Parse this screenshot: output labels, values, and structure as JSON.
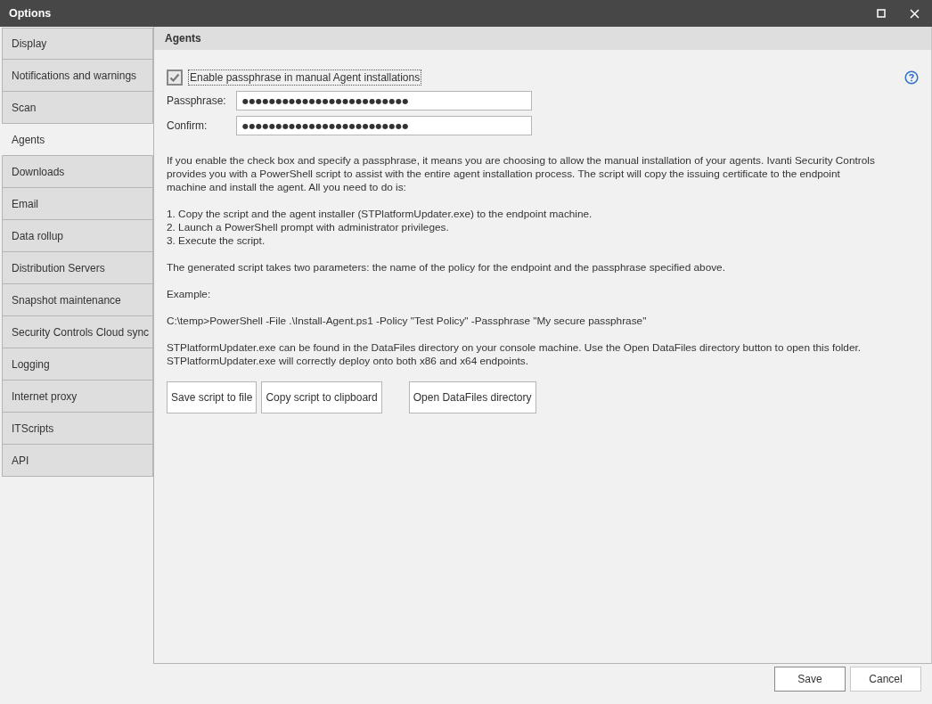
{
  "window": {
    "title": "Options"
  },
  "sidebar": {
    "items": [
      {
        "label": "Display",
        "selected": false
      },
      {
        "label": "Notifications and warnings",
        "selected": false
      },
      {
        "label": "Scan",
        "selected": false
      },
      {
        "label": "Agents",
        "selected": true
      },
      {
        "label": "Downloads",
        "selected": false
      },
      {
        "label": "Email",
        "selected": false
      },
      {
        "label": "Data rollup",
        "selected": false
      },
      {
        "label": "Distribution Servers",
        "selected": false
      },
      {
        "label": "Snapshot maintenance",
        "selected": false
      },
      {
        "label": "Security Controls Cloud sync",
        "selected": false
      },
      {
        "label": "Logging",
        "selected": false
      },
      {
        "label": "Internet proxy",
        "selected": false
      },
      {
        "label": "ITScripts",
        "selected": false
      },
      {
        "label": "API",
        "selected": false
      }
    ]
  },
  "panel": {
    "title": "Agents",
    "enable_checkbox": {
      "label": "Enable passphrase in manual Agent installations",
      "checked": true
    },
    "fields": [
      {
        "label": "Passphrase:",
        "value": "●●●●●●●●●●●●●●●●●●●●●●●●●"
      },
      {
        "label": "Confirm:",
        "value": "●●●●●●●●●●●●●●●●●●●●●●●●●"
      }
    ],
    "blocks": [
      {
        "lines": [
          "If you enable the check box and specify a passphrase, it means you are choosing to allow the manual installation of your agents. Ivanti Security Controls provides you with a PowerShell script to assist with the entire agent installation process. The script will copy the issuing certificate to the endpoint machine and install the agent. All you need to do is:"
        ]
      },
      {
        "lines": [
          "1. Copy the script and the agent installer (STPlatformUpdater.exe) to the endpoint machine.",
          "2. Launch a PowerShell prompt with administrator privileges.",
          "3. Execute the script."
        ]
      },
      {
        "lines": [
          "The generated script takes two parameters: the name of the policy for the endpoint and the passphrase specified above."
        ]
      },
      {
        "lines": [
          "Example:"
        ]
      },
      {
        "lines": [
          "C:\\temp>PowerShell -File .\\Install-Agent.ps1 -Policy \"Test Policy\" -Passphrase \"My secure passphrase\""
        ]
      },
      {
        "lines": [
          "STPlatformUpdater.exe can be found in the DataFiles directory on your console machine. Use the Open DataFiles directory button to open this folder.",
          "STPlatformUpdater.exe will correctly deploy onto both x86 and x64 endpoints."
        ]
      }
    ],
    "buttons": [
      "Save script to file",
      "Copy script to clipboard",
      "Open DataFiles directory"
    ]
  },
  "footer_buttons": [
    "Save",
    "Cancel"
  ]
}
